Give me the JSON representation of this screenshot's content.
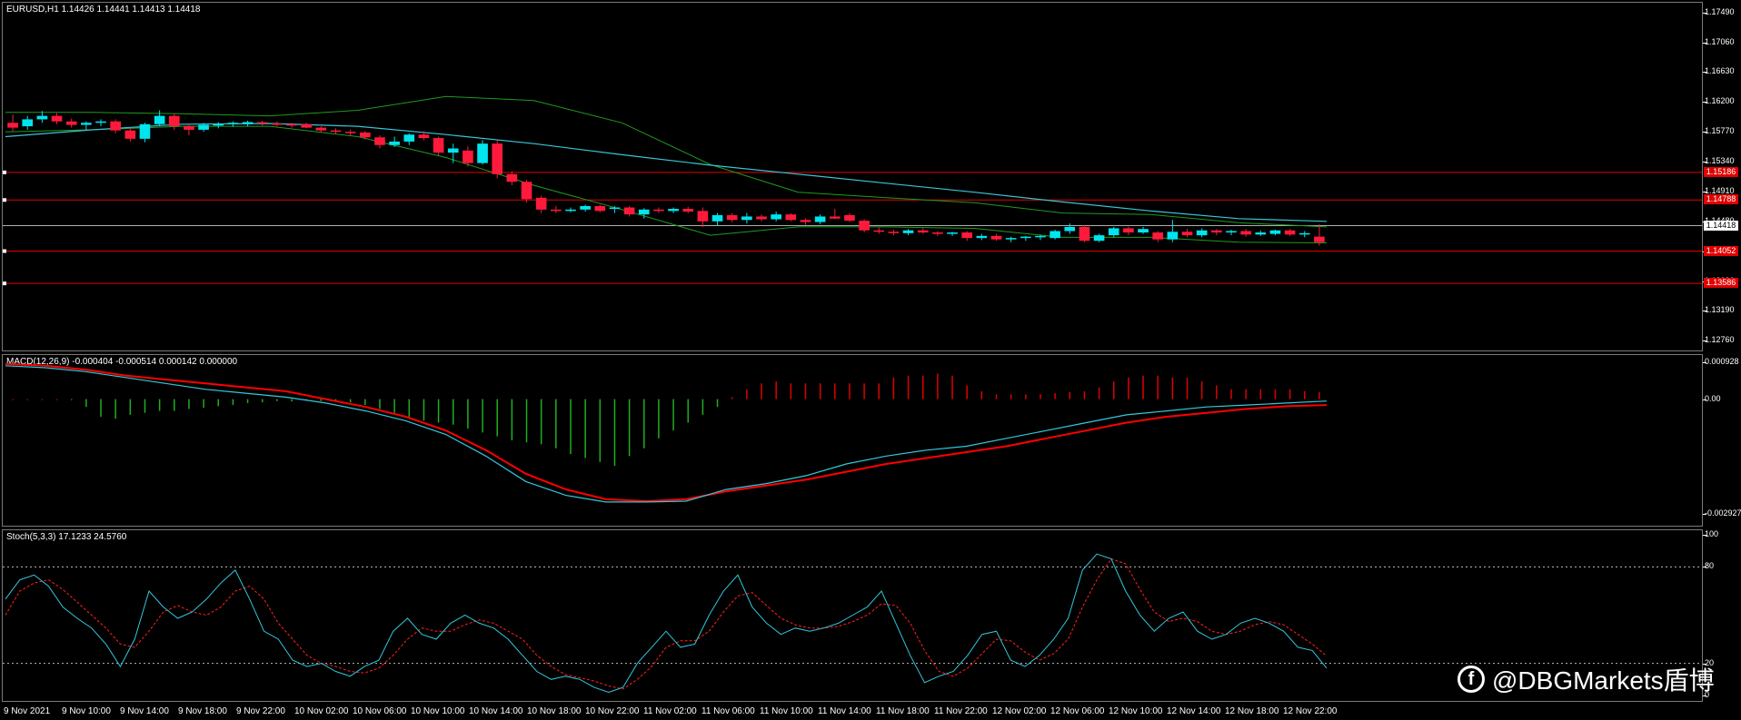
{
  "main_chart": {
    "header": "EURUSD,H1  1.14426 1.14441 1.14413 1.14418",
    "y_labels": [
      "1.17490",
      "1.17060",
      "1.16630",
      "1.16200",
      "1.15770",
      "1.15340",
      "1.14910",
      "1.14480",
      "1.14050",
      "1.13620",
      "1.13190",
      "1.12760"
    ],
    "current_price": "1.14418",
    "level_tags": [
      "1.15186",
      "1.14788",
      "1.14052",
      "1.13586"
    ],
    "colors": {
      "bull": "#00e5ee",
      "bear": "#ff1a3c",
      "bands": "#1f9a1f",
      "ma": "#39c5d6",
      "level": "#e00000",
      "current": "#b0b0b0"
    }
  },
  "macd": {
    "header": "MACD(12,26,9) -0.000404 -0.000514 0.000142 0.000000",
    "y_labels": [
      "0.000928",
      "0.00",
      "-0.002927"
    ]
  },
  "stoch": {
    "header": "Stoch(5,3,3) 17.1233 24.5760",
    "y_labels": [
      "100",
      "80",
      "20",
      "0"
    ]
  },
  "x_axis": {
    "labels": [
      "9 Nov 2021",
      "9 Nov 10:00",
      "9 Nov 14:00",
      "9 Nov 18:00",
      "9 Nov 22:00",
      "10 Nov 02:00",
      "10 Nov 06:00",
      "10 Nov 10:00",
      "10 Nov 14:00",
      "10 Nov 18:00",
      "10 Nov 22:00",
      "11 Nov 02:00",
      "11 Nov 06:00",
      "11 Nov 10:00",
      "11 Nov 14:00",
      "11 Nov 18:00",
      "11 Nov 22:00",
      "12 Nov 02:00",
      "12 Nov 06:00",
      "12 Nov 10:00",
      "12 Nov 14:00",
      "12 Nov 18:00",
      "12 Nov 22:00"
    ]
  },
  "watermark": {
    "icon": "dbg-logo-icon",
    "text": "@DBGMarkets盾博"
  },
  "chart_data": [
    {
      "type": "candlestick",
      "title": "EURUSD,H1",
      "ylim": [
        1.1262,
        1.1763
      ],
      "ohlc": [
        [
          1.159,
          1.1602,
          1.1578,
          1.1583
        ],
        [
          1.1585,
          1.16,
          1.158,
          1.1595
        ],
        [
          1.1595,
          1.1607,
          1.159,
          1.16
        ],
        [
          1.16,
          1.1604,
          1.1588,
          1.1592
        ],
        [
          1.1592,
          1.1596,
          1.1583,
          1.1587
        ],
        [
          1.1587,
          1.1592,
          1.158,
          1.159
        ],
        [
          1.159,
          1.1595,
          1.1585,
          1.1592
        ],
        [
          1.1592,
          1.1595,
          1.1575,
          1.1579
        ],
        [
          1.1579,
          1.1583,
          1.1563,
          1.1567
        ],
        [
          1.1567,
          1.159,
          1.1562,
          1.1588
        ],
        [
          1.1588,
          1.1608,
          1.1585,
          1.16
        ],
        [
          1.16,
          1.1603,
          1.158,
          1.1585
        ],
        [
          1.1585,
          1.1588,
          1.1572,
          1.158
        ],
        [
          1.158,
          1.159,
          1.1577,
          1.1587
        ],
        [
          1.1587,
          1.1591,
          1.1582,
          1.1588
        ],
        [
          1.1588,
          1.1592,
          1.1584,
          1.159
        ],
        [
          1.1588,
          1.1593,
          1.1585,
          1.1591
        ],
        [
          1.1591,
          1.1593,
          1.1586,
          1.1589
        ],
        [
          1.1589,
          1.1592,
          1.1585,
          1.1588
        ],
        [
          1.1588,
          1.159,
          1.1583,
          1.1586
        ],
        [
          1.1588,
          1.159,
          1.1582,
          1.1583
        ],
        [
          1.1583,
          1.1585,
          1.1576,
          1.1579
        ],
        [
          1.1579,
          1.1582,
          1.1574,
          1.1577
        ],
        [
          1.1577,
          1.158,
          1.1572,
          1.1576
        ],
        [
          1.1576,
          1.1578,
          1.1566,
          1.1569
        ],
        [
          1.1569,
          1.1572,
          1.1553,
          1.1558
        ],
        [
          1.1558,
          1.157,
          1.1555,
          1.1563
        ],
        [
          1.1563,
          1.1575,
          1.1558,
          1.1573
        ],
        [
          1.1573,
          1.1578,
          1.1565,
          1.1568
        ],
        [
          1.1568,
          1.157,
          1.1543,
          1.1547
        ],
        [
          1.1547,
          1.156,
          1.1532,
          1.1553
        ],
        [
          1.155,
          1.1556,
          1.1527,
          1.1532
        ],
        [
          1.1532,
          1.1565,
          1.153,
          1.156
        ],
        [
          1.156,
          1.1565,
          1.151,
          1.1516
        ],
        [
          1.1516,
          1.152,
          1.15,
          1.1505
        ],
        [
          1.1505,
          1.1508,
          1.1475,
          1.148
        ],
        [
          1.1482,
          1.1485,
          1.146,
          1.1465
        ],
        [
          1.1465,
          1.147,
          1.146,
          1.1463
        ],
        [
          1.1463,
          1.1468,
          1.1461,
          1.1465
        ],
        [
          1.1465,
          1.1472,
          1.1462,
          1.147
        ],
        [
          1.147,
          1.1472,
          1.1461,
          1.1463
        ],
        [
          1.1466,
          1.147,
          1.146,
          1.1468
        ],
        [
          1.1468,
          1.147,
          1.1455,
          1.1458
        ],
        [
          1.1458,
          1.1467,
          1.1452,
          1.1465
        ],
        [
          1.1465,
          1.1468,
          1.146,
          1.1463
        ],
        [
          1.1463,
          1.1468,
          1.146,
          1.1466
        ],
        [
          1.1466,
          1.1469,
          1.146,
          1.1462
        ],
        [
          1.1463,
          1.1468,
          1.144,
          1.1448
        ],
        [
          1.1448,
          1.146,
          1.1442,
          1.1457
        ],
        [
          1.1457,
          1.146,
          1.1447,
          1.145
        ],
        [
          1.145,
          1.146,
          1.1445,
          1.1455
        ],
        [
          1.1455,
          1.1458,
          1.1448,
          1.1451
        ],
        [
          1.1451,
          1.1462,
          1.1448,
          1.1458
        ],
        [
          1.1458,
          1.146,
          1.1448,
          1.145
        ],
        [
          1.145,
          1.1452,
          1.1443,
          1.1447
        ],
        [
          1.1447,
          1.1458,
          1.1444,
          1.1455
        ],
        [
          1.1455,
          1.1466,
          1.1451,
          1.1452
        ],
        [
          1.1457,
          1.146,
          1.1447,
          1.1449
        ],
        [
          1.1449,
          1.1451,
          1.1432,
          1.1435
        ],
        [
          1.1435,
          1.1439,
          1.143,
          1.1433
        ],
        [
          1.1433,
          1.1436,
          1.1428,
          1.1431
        ],
        [
          1.1431,
          1.1437,
          1.1428,
          1.1435
        ],
        [
          1.1435,
          1.1438,
          1.143,
          1.1432
        ],
        [
          1.1432,
          1.1434,
          1.1427,
          1.143
        ],
        [
          1.143,
          1.1433,
          1.1427,
          1.1432
        ],
        [
          1.1432,
          1.1434,
          1.142,
          1.1424
        ],
        [
          1.1424,
          1.143,
          1.1421,
          1.1427
        ],
        [
          1.1427,
          1.143,
          1.142,
          1.1422
        ],
        [
          1.1422,
          1.1426,
          1.1418,
          1.1424
        ],
        [
          1.1424,
          1.1427,
          1.142,
          1.1426
        ],
        [
          1.1426,
          1.1429,
          1.1421,
          1.1427
        ],
        [
          1.1424,
          1.1436,
          1.1422,
          1.1434
        ],
        [
          1.1434,
          1.1445,
          1.143,
          1.144
        ],
        [
          1.144,
          1.1443,
          1.1418,
          1.142
        ],
        [
          1.142,
          1.143,
          1.1418,
          1.1428
        ],
        [
          1.1428,
          1.144,
          1.1425,
          1.1438
        ],
        [
          1.1438,
          1.144,
          1.1428,
          1.1432
        ],
        [
          1.1432,
          1.144,
          1.143,
          1.1437
        ],
        [
          1.1432,
          1.1434,
          1.1418,
          1.1422
        ],
        [
          1.1422,
          1.145,
          1.1418,
          1.1433
        ],
        [
          1.1433,
          1.1437,
          1.1425,
          1.1428
        ],
        [
          1.1428,
          1.1438,
          1.1425,
          1.1435
        ],
        [
          1.1435,
          1.1437,
          1.1428,
          1.1432
        ],
        [
          1.1432,
          1.1436,
          1.1428,
          1.1434
        ],
        [
          1.1434,
          1.1437,
          1.1426,
          1.1429
        ],
        [
          1.1429,
          1.1435,
          1.1427,
          1.1432
        ],
        [
          1.143,
          1.1436,
          1.1428,
          1.1435
        ],
        [
          1.1435,
          1.1437,
          1.1427,
          1.1429
        ],
        [
          1.1429,
          1.1434,
          1.1425,
          1.1431
        ],
        [
          1.1426,
          1.1444,
          1.1413,
          1.1418
        ]
      ],
      "moving_average": [
        1.157,
        1.158,
        1.1588,
        1.1589,
        1.1585,
        1.1573,
        1.156,
        1.1544,
        1.1529,
        1.1516,
        1.1503,
        1.149,
        1.1476,
        1.1463,
        1.1452,
        1.1448
      ],
      "bb_upper": [
        1.1605,
        1.1605,
        1.1603,
        1.16,
        1.1608,
        1.1628,
        1.1622,
        1.159,
        1.153,
        1.149,
        1.1482,
        1.1475,
        1.146,
        1.1458,
        1.1446,
        1.144
      ],
      "bb_lower": [
        1.1577,
        1.158,
        1.1585,
        1.1585,
        1.157,
        1.154,
        1.15,
        1.1465,
        1.1428,
        1.144,
        1.144,
        1.1438,
        1.1425,
        1.1425,
        1.1418,
        1.1417
      ],
      "levels": [
        1.15186,
        1.14788,
        1.14052,
        1.13586
      ],
      "current": 1.14418
    },
    {
      "type": "bar",
      "title": "MACD(12,26,9)",
      "ylim": [
        -0.0032,
        0.0011
      ],
      "histogram": [
        2e-05,
        1e-05,
        1e-05,
        0.0,
        -2e-05,
        -0.0002,
        -0.00045,
        -0.0005,
        -0.0004,
        -0.00035,
        -0.0003,
        -0.0003,
        -0.00025,
        -0.00022,
        -0.00018,
        -0.00015,
        -0.0001,
        -8e-05,
        -5e-05,
        -6e-05,
        -4e-05,
        -5e-05,
        -4e-05,
        -8e-05,
        -0.00015,
        -0.00025,
        -0.00035,
        -0.00045,
        -0.00055,
        -0.0006,
        -0.00065,
        -0.00075,
        -0.00085,
        -0.00095,
        -0.00105,
        -0.0011,
        -0.00115,
        -0.00125,
        -0.0014,
        -0.0015,
        -0.0016,
        -0.0017,
        -0.00145,
        -0.00125,
        -0.001,
        -0.0008,
        -0.0006,
        -0.0004,
        -0.0002,
        5e-05,
        0.00025,
        0.0004,
        0.00045,
        0.0004,
        0.0004,
        0.0004,
        0.0004,
        0.0004,
        0.0004,
        0.0004,
        0.00055,
        0.0006,
        0.0006,
        0.00065,
        0.0006,
        0.00035,
        0.0002,
        0.00012,
        0.00012,
        0.00012,
        0.00012,
        0.00015,
        0.00018,
        0.0002,
        0.0003,
        0.00045,
        0.00055,
        0.0006,
        0.0006,
        0.00055,
        0.00055,
        0.00045,
        0.00035,
        0.00025,
        0.00025,
        0.00025,
        0.00025,
        0.00025,
        0.0002,
        0.00018
      ],
      "macd_line": [
        0.00085,
        0.0008,
        0.0007,
        0.00055,
        0.0004,
        0.00025,
        0.00015,
        5e-05,
        -0.0001,
        -0.0003,
        -0.00055,
        -0.0009,
        -0.00145,
        -0.0021,
        -0.00245,
        -0.00262,
        -0.00262,
        -0.0026,
        -0.0023,
        -0.00215,
        -0.00195,
        -0.00165,
        -0.00145,
        -0.0013,
        -0.0012,
        -0.001,
        -0.0008,
        -0.0006,
        -0.0004,
        -0.0003,
        -0.0002,
        -0.00015,
        -0.0001,
        -5e-05
      ],
      "signal_line": [
        0.0009,
        0.00085,
        0.00075,
        0.0006,
        0.0005,
        0.0004,
        0.0003,
        0.0002,
        0.0,
        -0.0002,
        -0.00045,
        -0.0008,
        -0.0013,
        -0.0019,
        -0.0023,
        -0.00255,
        -0.0026,
        -0.00255,
        -0.00235,
        -0.0022,
        -0.00205,
        -0.00185,
        -0.00165,
        -0.0015,
        -0.00135,
        -0.0012,
        -0.001,
        -0.0008,
        -0.0006,
        -0.00045,
        -0.00035,
        -0.00025,
        -0.00018,
        -0.00015
      ]
    },
    {
      "type": "line",
      "title": "Stoch(5,3,3)",
      "ylim": [
        0,
        100
      ],
      "levels": [
        80,
        20
      ],
      "main": [
        60,
        72,
        75,
        68,
        55,
        48,
        42,
        32,
        18,
        35,
        65,
        55,
        48,
        52,
        60,
        70,
        78,
        60,
        40,
        35,
        22,
        18,
        20,
        15,
        12,
        18,
        22,
        40,
        48,
        38,
        35,
        45,
        50,
        45,
        42,
        35,
        25,
        15,
        10,
        12,
        10,
        5,
        2,
        5,
        20,
        30,
        40,
        30,
        32,
        50,
        65,
        75,
        55,
        45,
        38,
        42,
        40,
        42,
        45,
        50,
        55,
        65,
        45,
        25,
        8,
        12,
        15,
        25,
        38,
        40,
        22,
        18,
        25,
        35,
        48,
        78,
        88,
        85,
        65,
        50,
        40,
        48,
        52,
        40,
        35,
        38,
        45,
        48,
        45,
        40,
        30,
        28,
        17
      ],
      "signal": [
        50,
        65,
        70,
        72,
        66,
        58,
        50,
        42,
        32,
        30,
        40,
        52,
        56,
        52,
        50,
        55,
        65,
        68,
        60,
        45,
        35,
        25,
        20,
        18,
        15,
        14,
        17,
        25,
        35,
        42,
        40,
        40,
        44,
        47,
        45,
        40,
        35,
        25,
        18,
        13,
        11,
        9,
        6,
        4,
        10,
        18,
        30,
        34,
        34,
        40,
        52,
        62,
        64,
        56,
        48,
        44,
        42,
        42,
        43,
        46,
        50,
        57,
        56,
        45,
        28,
        15,
        12,
        17,
        26,
        35,
        34,
        27,
        22,
        26,
        35,
        55,
        72,
        85,
        82,
        66,
        52,
        46,
        48,
        46,
        40,
        38,
        40,
        44,
        46,
        44,
        38,
        32,
        24.6
      ]
    }
  ]
}
